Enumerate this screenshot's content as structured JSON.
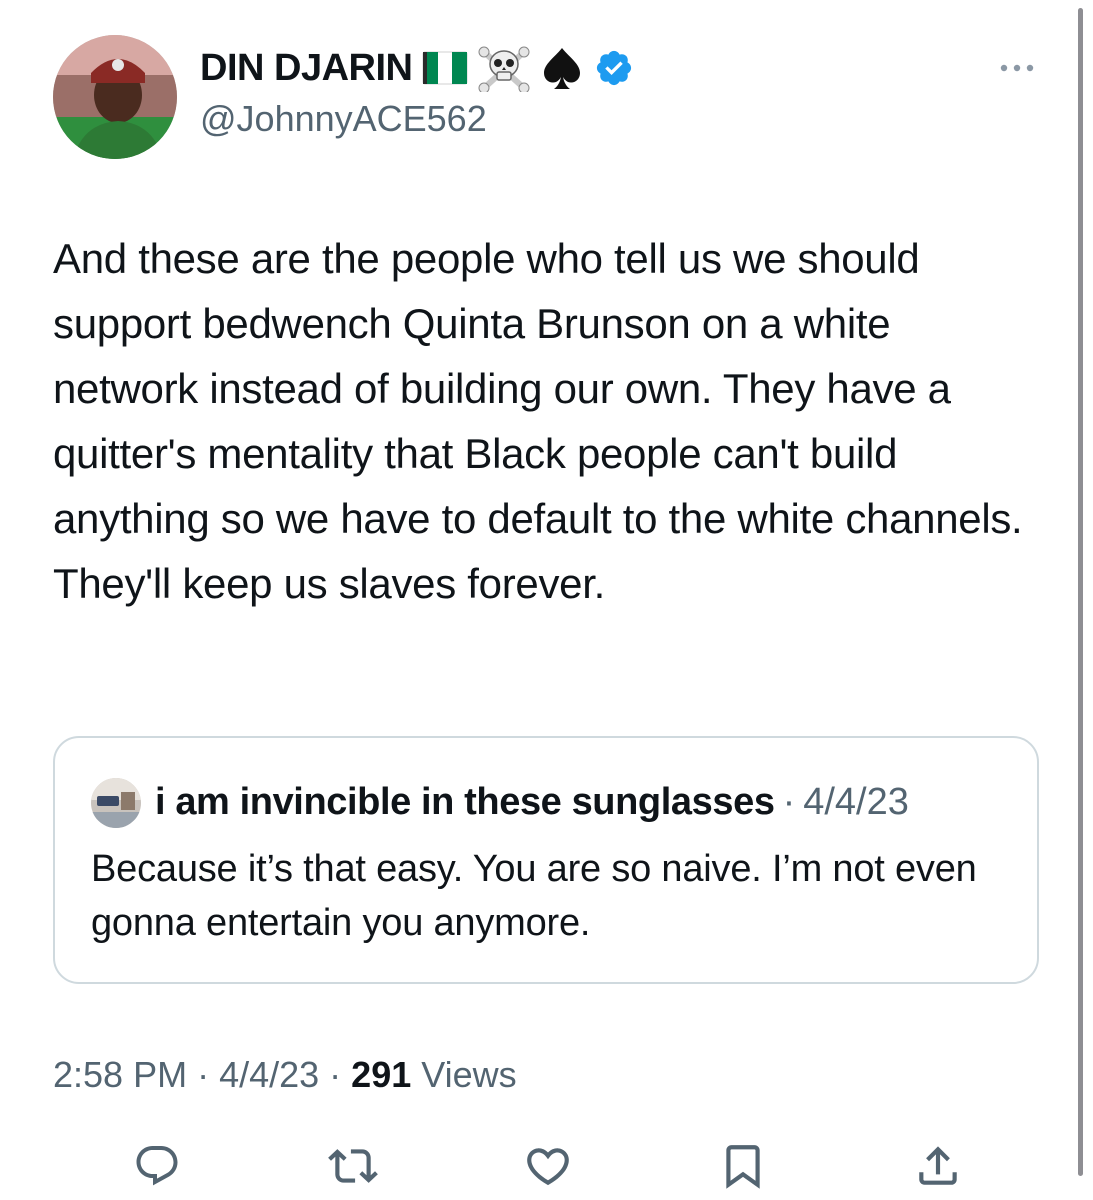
{
  "author": {
    "display_name": "DIN DJARIN",
    "name_emojis": [
      "nigeria-flag",
      "skull-and-crossbones",
      "spade-suit"
    ],
    "verified": true,
    "handle": "@JohnnyACE562"
  },
  "tweet": {
    "text": "And these are the people who tell us we should support bedwench Quinta Brunson on a white network instead of building our own. They have a quitter's mentality that Black people can't build anything so we have to default to the white channels. They'll keep us slaves forever."
  },
  "quote": {
    "display_name": "i am invincible in these sunglasses",
    "separator": "·",
    "date": "4/4/23",
    "text": "Because it’s that easy. You are so naive. I’m not even gonna entertain you anymore."
  },
  "meta": {
    "time": "2:58 PM",
    "separator": "·",
    "date": "4/4/23",
    "views_count": "291",
    "views_label": "Views"
  },
  "actions": [
    "reply-icon",
    "retweet-icon",
    "like-icon",
    "bookmark-icon",
    "share-icon"
  ],
  "colors": {
    "text_primary": "#0f1419",
    "text_secondary": "#536471",
    "border": "#cfd9de",
    "verified_blue": "#1d9bf0",
    "nigeria_green": "#008751"
  }
}
